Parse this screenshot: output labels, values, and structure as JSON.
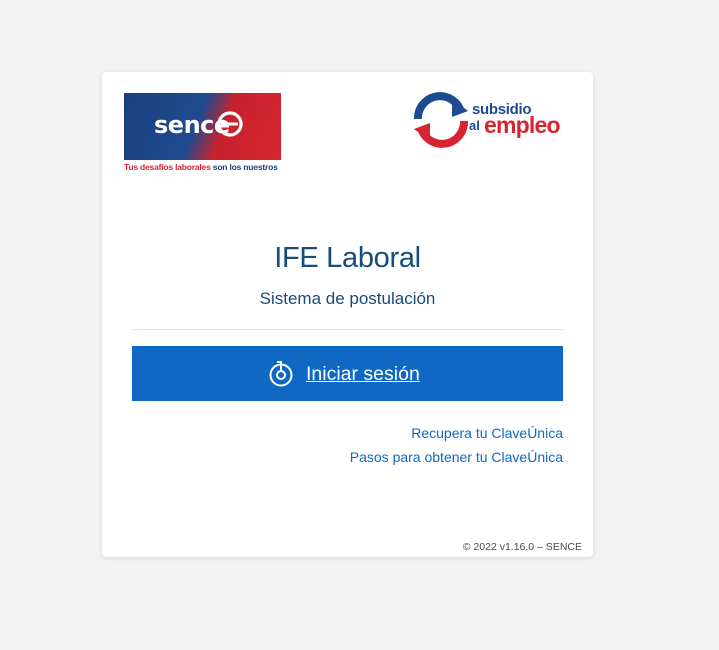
{
  "logos": {
    "sence": {
      "wordmark": "sence",
      "tagline_part1": "Tus desafíos laborales",
      "tagline_part2": " son los nuestros"
    },
    "subsidio": {
      "line1": "subsidio",
      "line2_small": "al",
      "line2_big": "empleo"
    }
  },
  "main": {
    "title": "IFE Laboral",
    "subtitle": "Sistema de postulación"
  },
  "login": {
    "button_label": "Iniciar sesión",
    "icon": "clave-unica-icon"
  },
  "links": {
    "recover": "Recupera tu ClaveÚnica",
    "steps": "Pasos para obtener tu ClaveÚnica"
  },
  "footer": {
    "text": "© 2022 v1.16.0 – SENCE"
  },
  "colors": {
    "page_background": "#f2f2f2",
    "card_background": "#ffffff",
    "title_color": "#164c79",
    "button_color": "#0f69c4",
    "link_color": "#0f69c4",
    "brand_red": "#d62530",
    "brand_blue": "#1b3f7e"
  }
}
